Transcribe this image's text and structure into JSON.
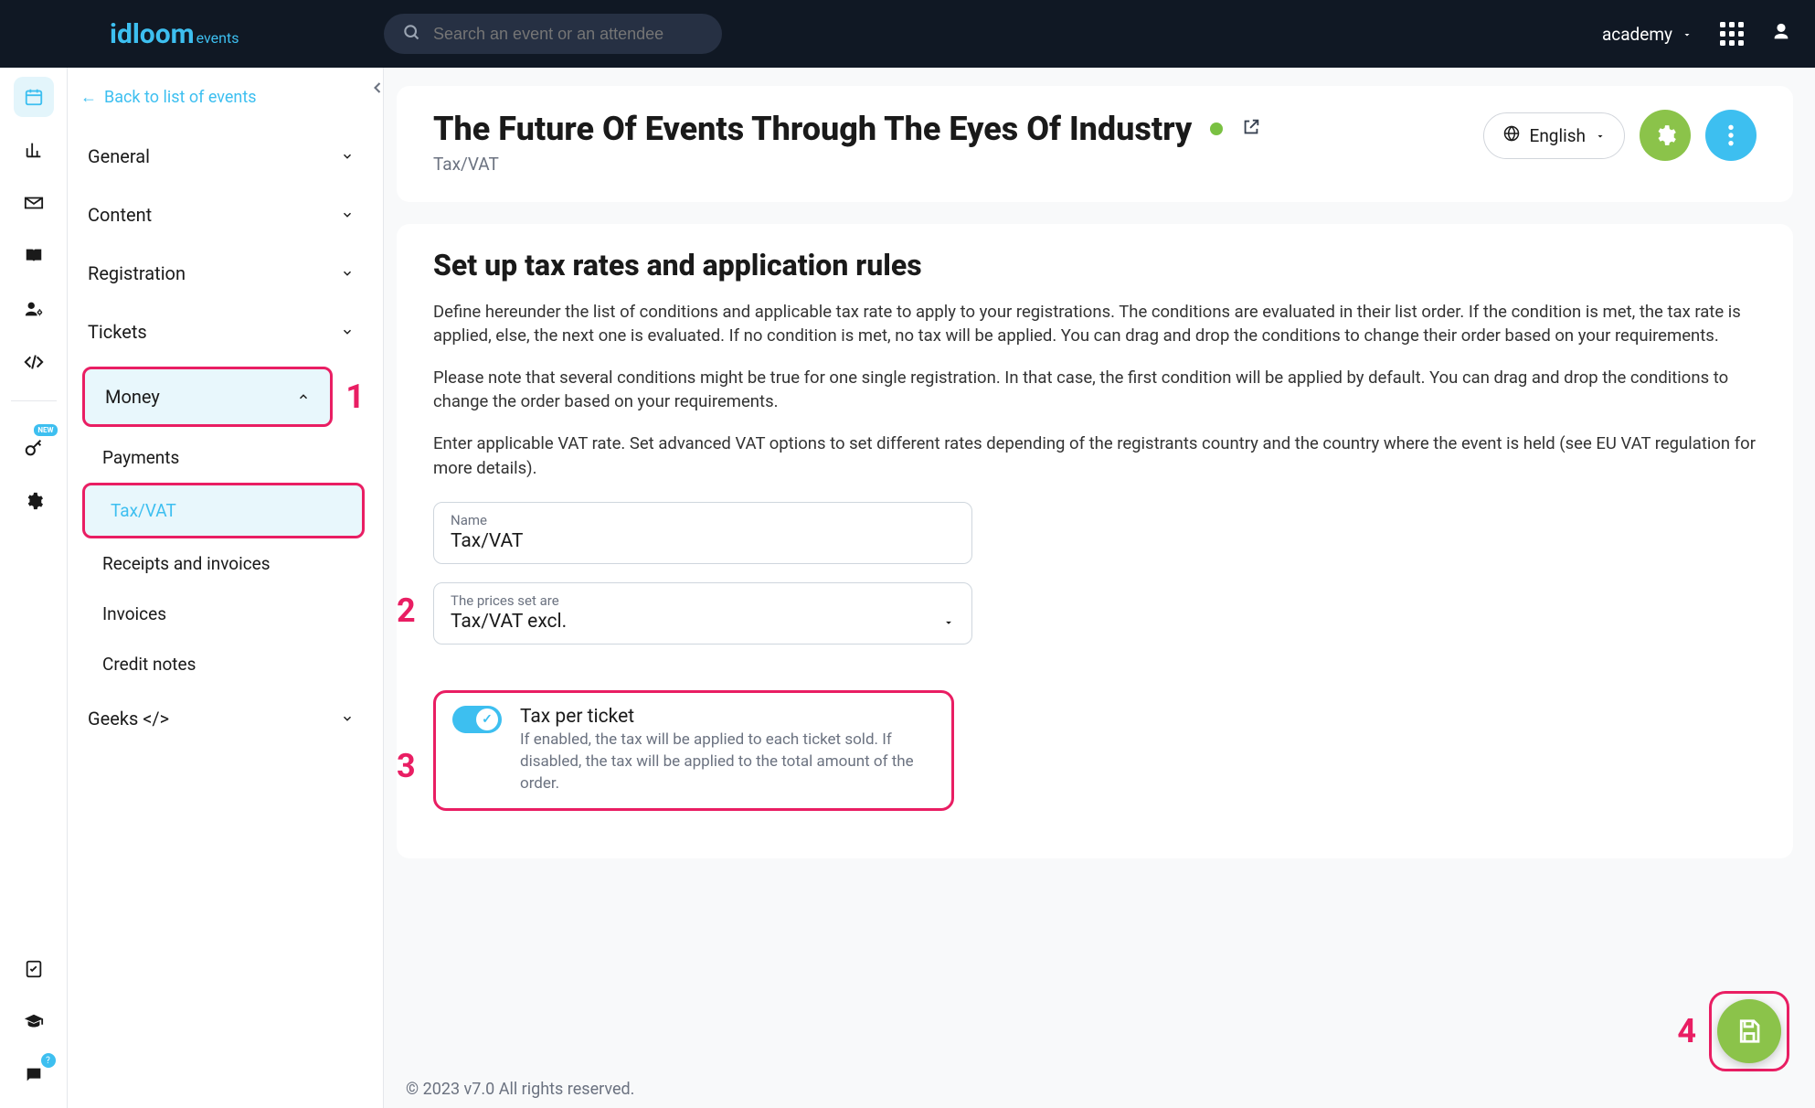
{
  "topbar": {
    "logo": {
      "brand": "idloom",
      "suffix": "events"
    },
    "search_placeholder": "Search an event or an attendee",
    "account_label": "academy"
  },
  "rail": {
    "new_badge": "NEW",
    "help_badge": "?"
  },
  "sidenav": {
    "back": "Back to list of events",
    "groups": {
      "general": "General",
      "content": "Content",
      "registration": "Registration",
      "tickets": "Tickets",
      "money": "Money",
      "geeks": "Geeks </>"
    },
    "money_sub": {
      "payments": "Payments",
      "taxvat": "Tax/VAT",
      "receipts": "Receipts and invoices",
      "invoices": "Invoices",
      "credit": "Credit notes"
    }
  },
  "annotations": {
    "1": "1",
    "2": "2",
    "3": "3",
    "4": "4"
  },
  "header": {
    "event_title": "The Future Of Events Through The Eyes Of Industry",
    "crumb": "Tax/VAT",
    "language": "English"
  },
  "section": {
    "title": "Set up tax rates and application rules",
    "p1": "Define hereunder the list of conditions and applicable tax rate to apply to your registrations. The conditions are evaluated in their list order. If the condition is met, the tax rate is applied, else, the next one is evaluated. If no condition is met, no tax will be applied. You can drag and drop the conditions to change their order based on your requirements.",
    "p2": "Please note that several conditions might be true for one single registration. In that case, the first condition will be applied by default. You can drag and drop the conditions to change the order based on your requirements.",
    "p3": "Enter applicable VAT rate. Set advanced VAT options to set different rates depending of the registrants country and the country where the event is held (see EU VAT regulation for more details)."
  },
  "form": {
    "name_label": "Name",
    "name_value": "Tax/VAT",
    "prices_label": "The prices set are",
    "prices_value": "Tax/VAT excl."
  },
  "toggle": {
    "title": "Tax per ticket",
    "desc": "If enabled, the tax will be applied to each ticket sold. If disabled, the tax will be applied to the total amount of the order."
  },
  "footer": "© 2023 v7.0 All rights reserved."
}
